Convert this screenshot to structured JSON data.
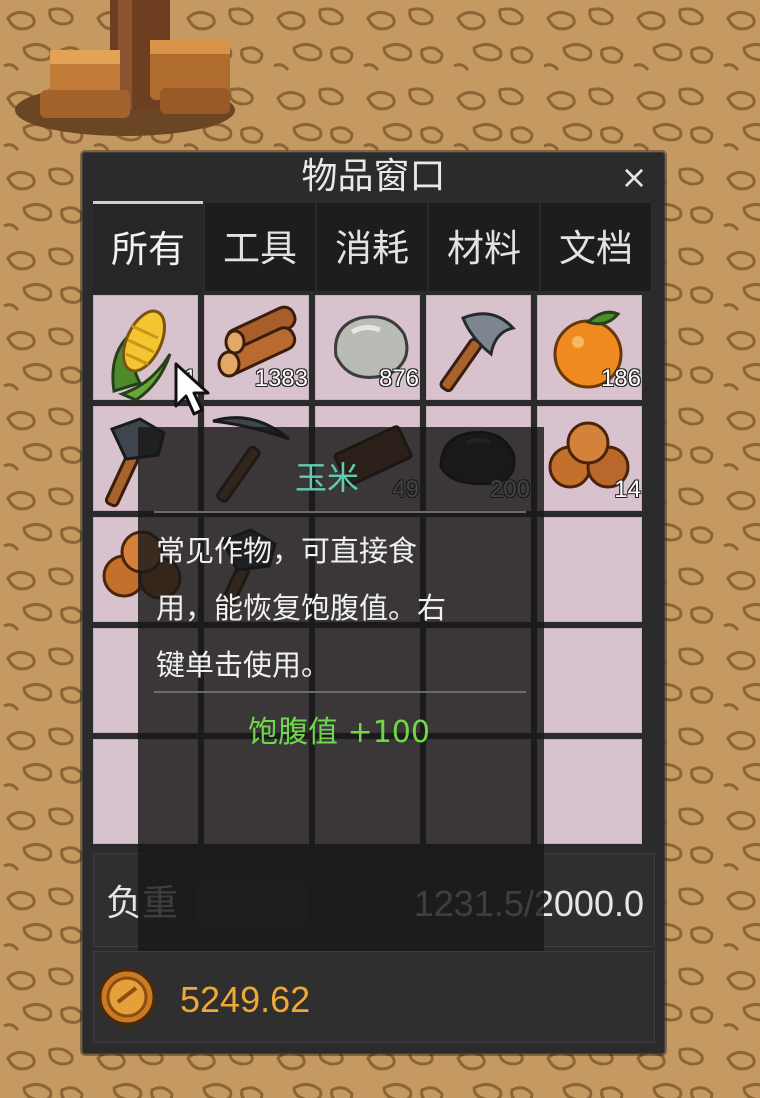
{
  "window": {
    "title": "物品窗口",
    "close_label": "×"
  },
  "tabs": [
    {
      "label": "所有",
      "active": true
    },
    {
      "label": "工具",
      "active": false
    },
    {
      "label": "消耗",
      "active": false
    },
    {
      "label": "材料",
      "active": false
    },
    {
      "label": "文档",
      "active": false
    }
  ],
  "slots": [
    {
      "icon": "corn-icon",
      "count": "1"
    },
    {
      "icon": "wood-logs-icon",
      "count": "1383"
    },
    {
      "icon": "stone-icon",
      "count": "876"
    },
    {
      "icon": "axe-icon",
      "count": ""
    },
    {
      "icon": "orange-icon",
      "count": "186"
    },
    {
      "icon": "hammer-icon",
      "count": ""
    },
    {
      "icon": "pickaxe-icon",
      "count": ""
    },
    {
      "icon": "wood-plank-icon",
      "count": "49"
    },
    {
      "icon": "coal-icon",
      "count": "200"
    },
    {
      "icon": "copper-ore-icon",
      "count": "14"
    },
    {
      "icon": "copper-ore-icon",
      "count": ""
    },
    {
      "icon": "hammer-icon",
      "count": ""
    }
  ],
  "weight": {
    "label": "负重",
    "value": "1231.5/2000.0"
  },
  "money": {
    "icon": "coin-icon",
    "value": "5249.62"
  },
  "tooltip": {
    "name": "玉米",
    "description_lines": [
      "常见作物，可直接食",
      "用，能恢复饱腹值。右",
      "键单击使用。"
    ],
    "effect": "饱腹值 +100"
  },
  "colors": {
    "item_name": "#5fcbb0",
    "effect": "#6ed84a",
    "money": "#f0a835",
    "slot_bg": "#d8c2cd",
    "panel_bg": "#2b2b2b"
  }
}
